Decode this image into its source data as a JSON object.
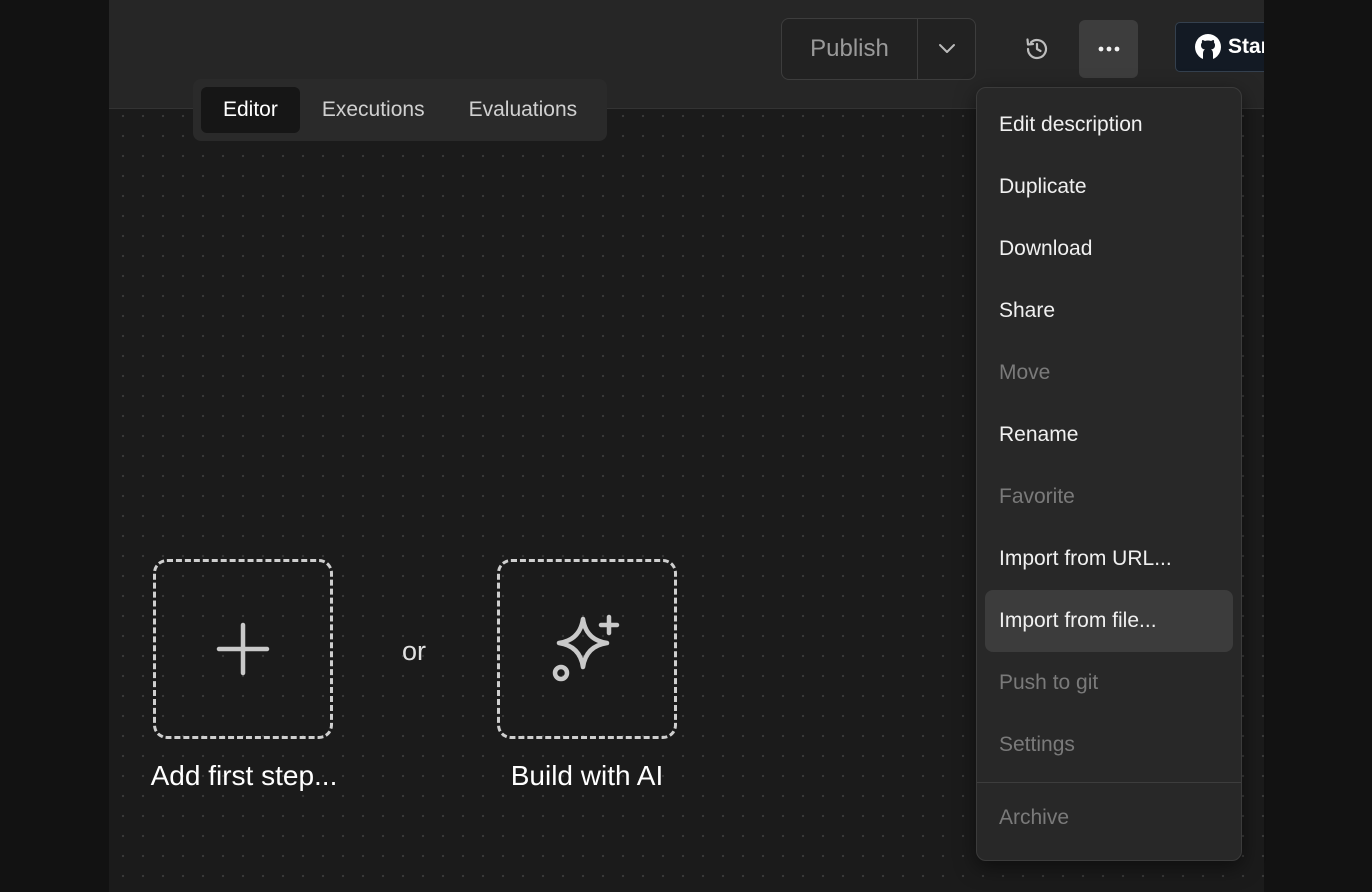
{
  "header": {
    "tabs": [
      {
        "label": "Editor"
      },
      {
        "label": "Executions"
      },
      {
        "label": "Evaluations"
      }
    ],
    "publish_label": "Publish",
    "star_label": "Star"
  },
  "menu": {
    "items": [
      {
        "label": "Edit description",
        "disabled": false
      },
      {
        "label": "Duplicate",
        "disabled": false
      },
      {
        "label": "Download",
        "disabled": false
      },
      {
        "label": "Share",
        "disabled": false
      },
      {
        "label": "Move",
        "disabled": true
      },
      {
        "label": "Rename",
        "disabled": false
      },
      {
        "label": "Favorite",
        "disabled": true
      },
      {
        "label": "Import from URL...",
        "disabled": false
      },
      {
        "label": "Import from file...",
        "disabled": false,
        "hovered": true
      },
      {
        "label": "Push to git",
        "disabled": true
      },
      {
        "label": "Settings",
        "disabled": true
      }
    ],
    "footer_item": {
      "label": "Archive",
      "disabled": true
    }
  },
  "canvas": {
    "add_step_label": "Add first step...",
    "or_label": "or",
    "build_ai_label": "Build with AI"
  },
  "icons": {
    "publish_caret": "chevron-down-icon",
    "history": "history-icon",
    "more": "more-horizontal-icon",
    "github": "github-icon",
    "add": "plus-icon",
    "ai": "sparkles-icon"
  }
}
